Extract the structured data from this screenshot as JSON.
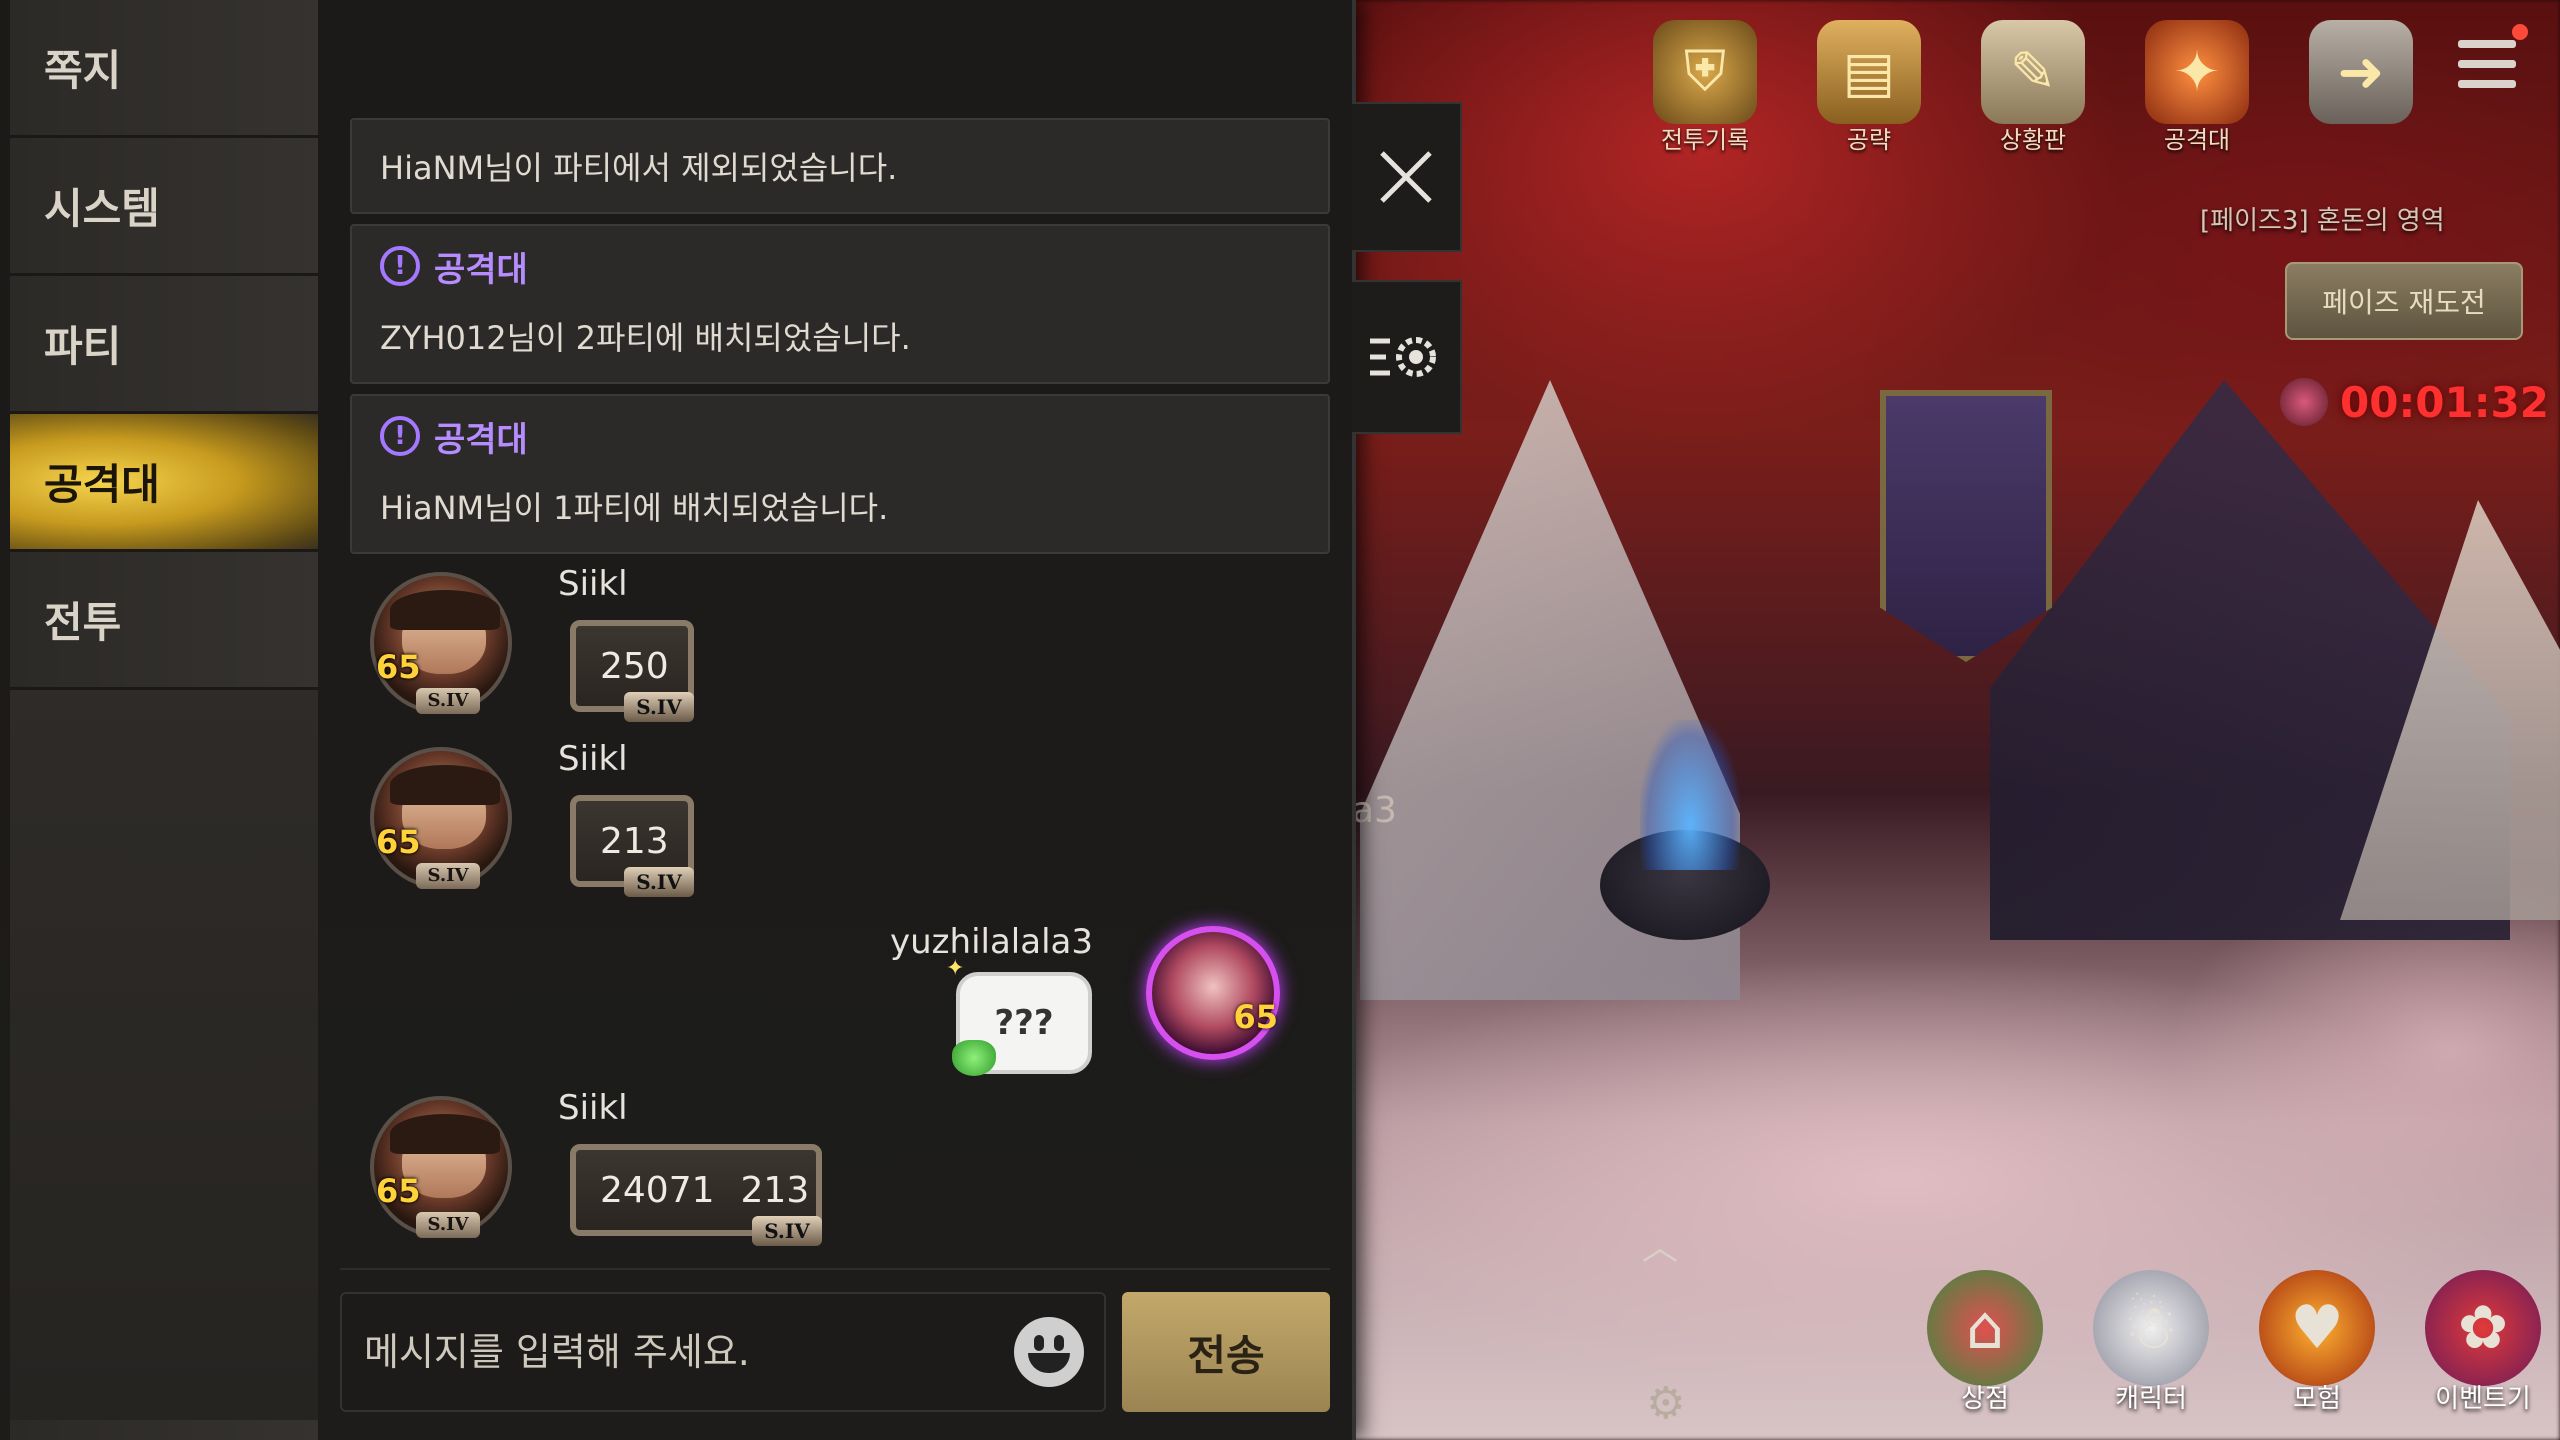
{
  "sidebar": {
    "tabs": [
      {
        "label": "쪽지"
      },
      {
        "label": "시스템"
      },
      {
        "label": "파티"
      },
      {
        "label": "공격대"
      },
      {
        "label": "전투"
      }
    ],
    "active_index": 3
  },
  "system_messages": [
    {
      "tag": "",
      "text": "HiaNM님이 파티에서 제외되었습니다."
    },
    {
      "tag": "공격대",
      "text": "ZYH012님이 2파티에 배치되었습니다."
    },
    {
      "tag": "공격대",
      "text": "HiaNM님이 1파티에 배치되었습니다."
    }
  ],
  "chat": [
    {
      "name": "Siikl",
      "level": "65",
      "rank": "S.IV",
      "badge": [
        "250"
      ]
    },
    {
      "name": "Siikl",
      "level": "65",
      "rank": "S.IV",
      "badge": [
        "213"
      ]
    },
    {
      "name": "Siikl",
      "level": "65",
      "rank": "S.IV",
      "badge": [
        "24071",
        "213"
      ]
    }
  ],
  "my_message": {
    "name": "yuzhilalala3",
    "level": "65",
    "text": "???"
  },
  "input": {
    "placeholder": "메시지를 입력해 주세요.",
    "value": ""
  },
  "send_label": "전송",
  "top_menu": [
    {
      "label": "전투기록",
      "icon": "shield-icon"
    },
    {
      "label": "공략",
      "icon": "book-icon"
    },
    {
      "label": "상황판",
      "icon": "board-icon"
    },
    {
      "label": "공격대",
      "icon": "raid-icon"
    },
    {
      "label": "",
      "icon": "exit-icon"
    }
  ],
  "phase": {
    "title": "[페이즈3] 혼돈의 영역",
    "retry_label": "페이즈 재도전",
    "timer": "00:01:32"
  },
  "bottom_menu": [
    {
      "label": "상점",
      "icon": "shop-icon"
    },
    {
      "label": "캐릭터",
      "icon": "character-icon"
    },
    {
      "label": "모험",
      "icon": "adventure-icon"
    },
    {
      "label": "이벤트기",
      "icon": "event-icon"
    }
  ],
  "side_text": "a3",
  "colors": {
    "accent": "#f6d44e",
    "raid_purple": "#b68cff",
    "timer_red": "#ff3030"
  }
}
